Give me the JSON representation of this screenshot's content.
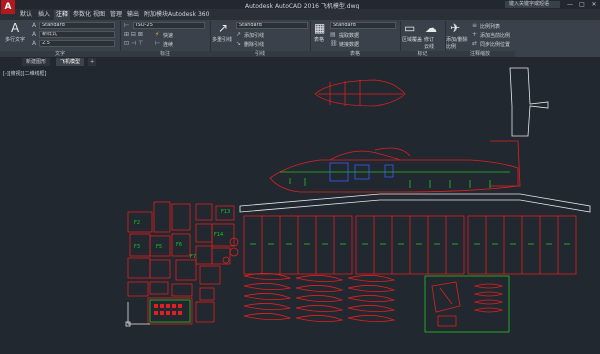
{
  "app": {
    "logo_letter": "A",
    "title": "Autodesk AutoCAD 2016   飞机模型.dwg",
    "badge": "键入关键字或短语",
    "window_buttons": [
      "—",
      "□",
      "✕"
    ]
  },
  "menu_tabs": [
    "默认",
    "插入",
    "注释",
    "参数化",
    "视图",
    "管理",
    "输出",
    "附加模块",
    "Autodesk 360"
  ],
  "ribbon": {
    "text_group": {
      "big_button": "多行文字",
      "style_combo": "Standard",
      "font_combo": "新样式",
      "height_combo": "2.5",
      "footer": "文字"
    },
    "dim_group": {
      "combo": "ISO-25",
      "quick_label": "快速",
      "continue_label": "连续",
      "footer": "标注"
    },
    "leader_group": {
      "big_button": "多重引线",
      "combo": "Standard",
      "add_label": "添加引线",
      "remove_label": "删除引线",
      "footer": "引线"
    },
    "table_group": {
      "big_button": "表格",
      "combo": "Standard",
      "extract_label": "提取数据",
      "link_label": "链接数据",
      "footer": "表格"
    },
    "markup_group": {
      "cloud_button": "区域覆盖",
      "revcloud_button": "修订云线",
      "footer": "标记"
    },
    "scale_group": {
      "add_button": "添加/删除比例",
      "list_label": "比例列表",
      "add_current_label": "添加当前比例",
      "sync_label": "同步比例位置",
      "footer": "注释缩放"
    }
  },
  "doc_tabs": [
    "新建图形",
    "飞机模型"
  ],
  "canvas": {
    "view_label": "[-][俯视][二维线框]",
    "part_labels": [
      "F13",
      "F14",
      "F2",
      "F3",
      "F5",
      "F6",
      "F7"
    ]
  },
  "colors": {
    "drawing_red": "#e02020",
    "drawing_green": "#22c422",
    "drawing_white": "#e8e8e8",
    "drawing_blue": "#3a5cff",
    "canvas_bg": "#212830"
  }
}
